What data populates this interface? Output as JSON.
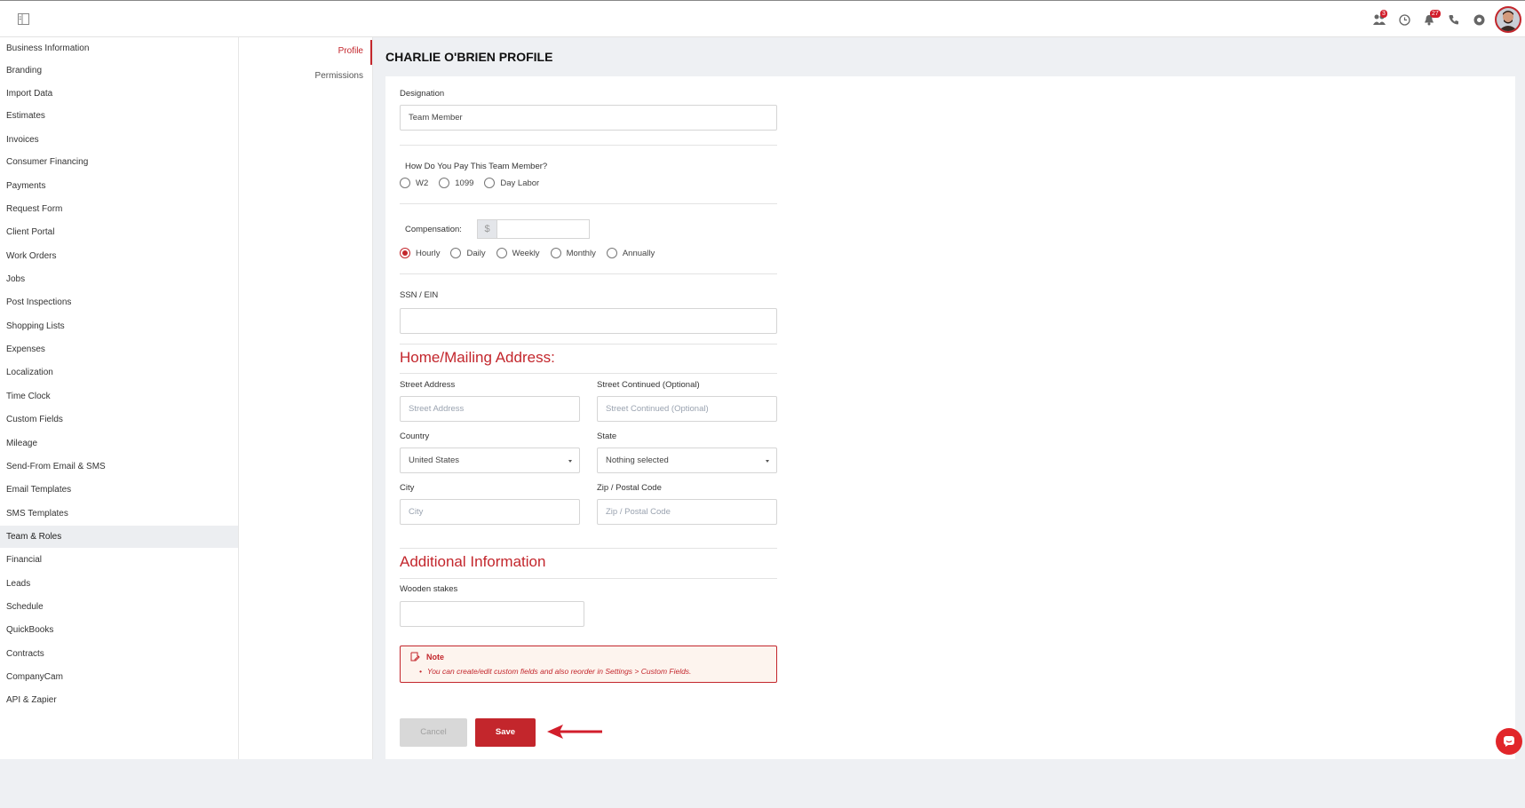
{
  "topbar": {
    "icons": [
      {
        "name": "team-icon",
        "badge": "3"
      },
      {
        "name": "clock-icon",
        "badge": ""
      },
      {
        "name": "bell-icon",
        "badge": "27"
      },
      {
        "name": "phone-icon",
        "badge": ""
      },
      {
        "name": "help-icon",
        "badge": ""
      }
    ]
  },
  "sidebar": {
    "items": [
      {
        "label": "Business Information"
      },
      {
        "label": "Branding"
      },
      {
        "label": "Import Data"
      },
      {
        "label": "Estimates"
      },
      {
        "label": "Invoices"
      },
      {
        "label": "Consumer Financing"
      },
      {
        "label": "Payments"
      },
      {
        "label": "Request Form"
      },
      {
        "label": "Client Portal"
      },
      {
        "label": "Work Orders"
      },
      {
        "label": "Jobs"
      },
      {
        "label": "Post Inspections"
      },
      {
        "label": "Shopping Lists"
      },
      {
        "label": "Expenses"
      },
      {
        "label": "Localization"
      },
      {
        "label": "Time Clock"
      },
      {
        "label": "Custom Fields"
      },
      {
        "label": "Mileage"
      },
      {
        "label": "Send-From Email & SMS"
      },
      {
        "label": "Email Templates"
      },
      {
        "label": "SMS Templates"
      },
      {
        "label": "Team & Roles",
        "active": true
      },
      {
        "label": "Financial"
      },
      {
        "label": "Leads"
      },
      {
        "label": "Schedule"
      },
      {
        "label": "QuickBooks"
      },
      {
        "label": "Contracts"
      },
      {
        "label": "CompanyCam"
      },
      {
        "label": "API & Zapier"
      }
    ]
  },
  "subnav": {
    "profile": "Profile",
    "permissions": "Permissions"
  },
  "page": {
    "title": "CHARLIE O'BRIEN PROFILE"
  },
  "form": {
    "designation_label": "Designation",
    "designation_value": "Team Member",
    "pay_question": "How Do You Pay This Team Member?",
    "pay_options": [
      "W2",
      "1099",
      "Day Labor"
    ],
    "compensation_label": "Compensation:",
    "currency_symbol": "$",
    "compensation_value": "",
    "period_options": [
      "Hourly",
      "Daily",
      "Weekly",
      "Monthly",
      "Annually"
    ],
    "period_selected": "Hourly",
    "ssn_label": "SSN / EIN",
    "ssn_value": "",
    "address_heading": "Home/Mailing Address:",
    "street_label": "Street Address",
    "street_placeholder": "Street Address",
    "street2_label": "Street Continued (Optional)",
    "street2_placeholder": "Street Continued (Optional)",
    "country_label": "Country",
    "country_value": "United States",
    "state_label": "State",
    "state_value": "Nothing selected",
    "city_label": "City",
    "city_placeholder": "City",
    "zip_label": "Zip / Postal Code",
    "zip_placeholder": "Zip / Postal Code",
    "additional_heading": "Additional Information",
    "wooden_stakes_label": "Wooden stakes",
    "wooden_stakes_value": ""
  },
  "note": {
    "title": "Note",
    "text": "You can create/edit custom fields and also reorder in Settings > Custom Fields."
  },
  "buttons": {
    "cancel": "Cancel",
    "save": "Save"
  },
  "colors": {
    "accent": "#c3262c",
    "note_bg": "#fdf4ee"
  }
}
